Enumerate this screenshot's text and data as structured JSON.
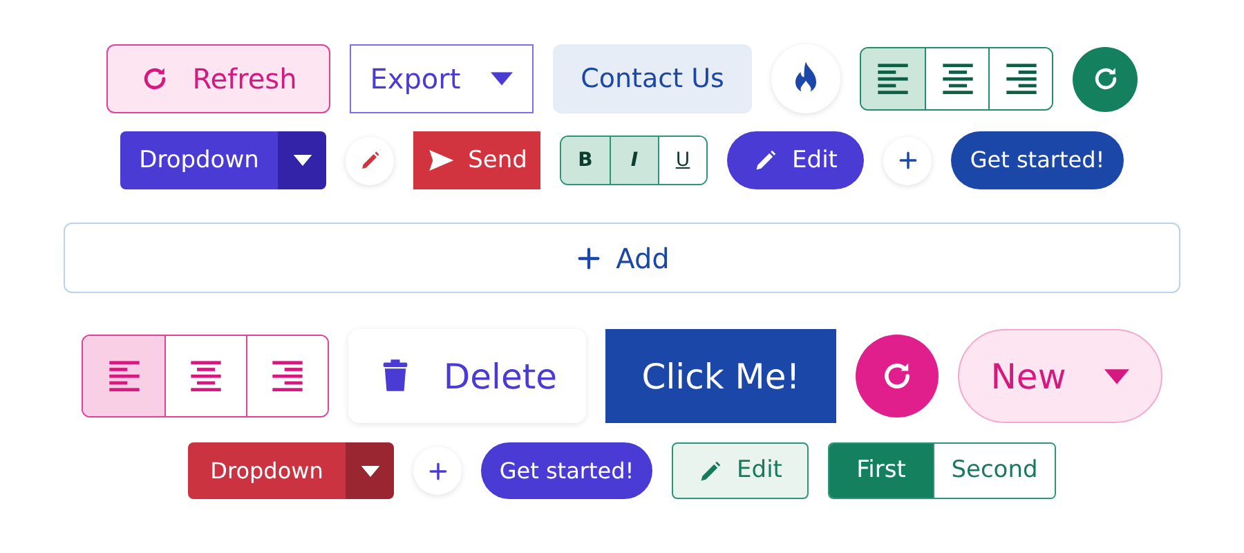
{
  "rows": [
    {
      "items": [
        {
          "kind": "button",
          "label": "Refresh"
        },
        {
          "kind": "dropdown",
          "label": "Export"
        },
        {
          "kind": "button",
          "label": "Contact Us"
        },
        {
          "kind": "icon-button"
        },
        {
          "kind": "group",
          "buttons": [
            {
              "selected": true
            },
            {
              "selected": false
            },
            {
              "selected": false
            }
          ]
        },
        {
          "kind": "icon-button"
        }
      ]
    },
    {
      "items": [
        {
          "kind": "split",
          "label": "Dropdown"
        },
        {
          "kind": "icon-button"
        },
        {
          "kind": "button",
          "label": "Send"
        },
        {
          "kind": "group",
          "buttons": [
            {
              "label": "B",
              "selected": true
            },
            {
              "label": "I",
              "selected": true
            },
            {
              "label": "U",
              "selected": false
            }
          ]
        },
        {
          "kind": "button",
          "label": "Edit"
        },
        {
          "kind": "icon-button"
        },
        {
          "kind": "button",
          "label": "Get started!"
        }
      ]
    },
    {
      "items": [
        {
          "kind": "button",
          "label": "Add"
        }
      ]
    },
    {
      "items": [
        {
          "kind": "group",
          "buttons": [
            {
              "selected": true
            },
            {
              "selected": false
            },
            {
              "selected": false
            }
          ]
        },
        {
          "kind": "button",
          "label": "Delete"
        },
        {
          "kind": "button",
          "label": "Click Me!"
        },
        {
          "kind": "icon-button"
        },
        {
          "kind": "dropdown",
          "label": "New"
        }
      ]
    },
    {
      "items": [
        {
          "kind": "split",
          "label": "Dropdown"
        },
        {
          "kind": "icon-button"
        },
        {
          "kind": "button",
          "label": "Get started!"
        },
        {
          "kind": "button",
          "label": "Edit"
        },
        {
          "kind": "group",
          "buttons": [
            {
              "label": "First",
              "selected": true
            },
            {
              "label": "Second",
              "selected": false
            }
          ]
        }
      ]
    }
  ]
}
